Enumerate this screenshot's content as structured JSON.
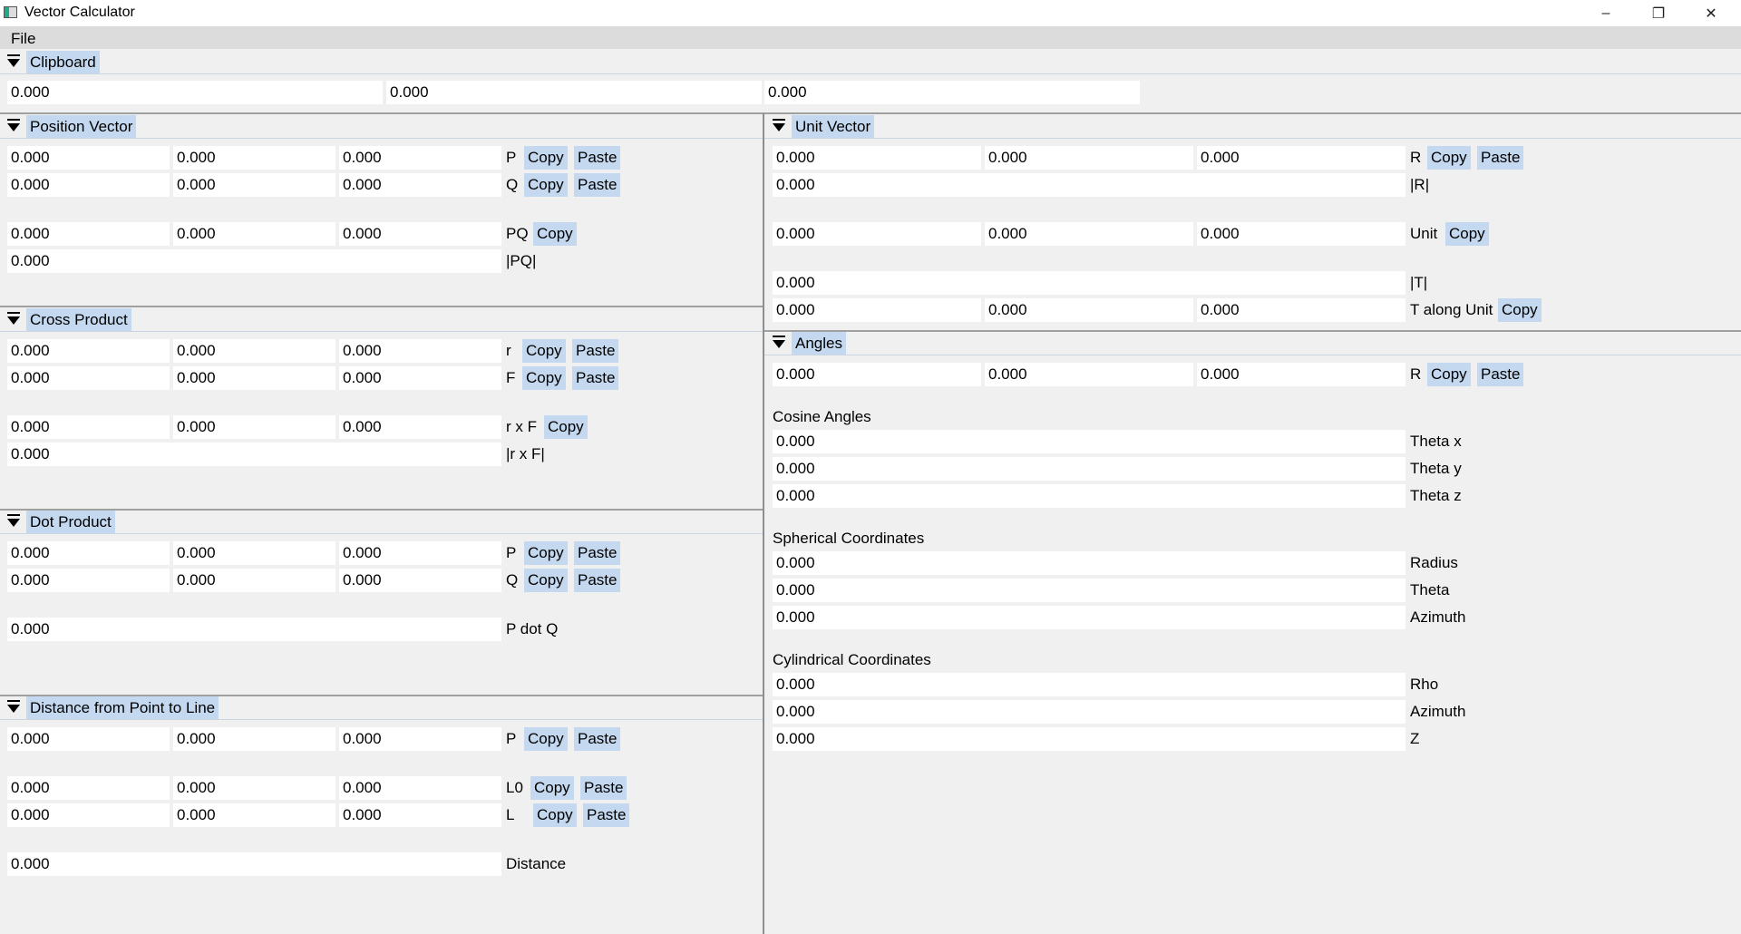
{
  "window": {
    "title": "Vector Calculator",
    "minimize": "–",
    "restore": "❐",
    "close": "✕"
  },
  "menu": {
    "file": "File"
  },
  "clipboard": {
    "title": "Clipboard",
    "values": [
      "0.000",
      "0.000",
      "0.000"
    ]
  },
  "position_vector": {
    "title": "Position Vector",
    "p": {
      "values": [
        "0.000",
        "0.000",
        "0.000"
      ],
      "label": "P"
    },
    "q": {
      "values": [
        "0.000",
        "0.000",
        "0.000"
      ],
      "label": "Q"
    },
    "pq": {
      "values": [
        "0.000",
        "0.000",
        "0.000"
      ],
      "label": "PQ"
    },
    "pq_mag": {
      "value": "0.000",
      "label": "|PQ|"
    }
  },
  "cross_product": {
    "title": "Cross Product",
    "r": {
      "values": [
        "0.000",
        "0.000",
        "0.000"
      ],
      "label": "r"
    },
    "f": {
      "values": [
        "0.000",
        "0.000",
        "0.000"
      ],
      "label": "F"
    },
    "rxf": {
      "values": [
        "0.000",
        "0.000",
        "0.000"
      ],
      "label": "r x F"
    },
    "rxf_mag": {
      "value": "0.000",
      "label": "|r x F|"
    }
  },
  "dot_product": {
    "title": "Dot Product",
    "p": {
      "values": [
        "0.000",
        "0.000",
        "0.000"
      ],
      "label": "P"
    },
    "q": {
      "values": [
        "0.000",
        "0.000",
        "0.000"
      ],
      "label": "Q"
    },
    "pdotq": {
      "value": "0.000",
      "label": "P dot Q"
    }
  },
  "distance": {
    "title": "Distance from Point to Line",
    "p": {
      "values": [
        "0.000",
        "0.000",
        "0.000"
      ],
      "label": "P"
    },
    "l0": {
      "values": [
        "0.000",
        "0.000",
        "0.000"
      ],
      "label": "L0"
    },
    "l": {
      "values": [
        "0.000",
        "0.000",
        "0.000"
      ],
      "label": "L"
    },
    "dist": {
      "value": "0.000",
      "label": "Distance"
    }
  },
  "unit_vector": {
    "title": "Unit Vector",
    "r": {
      "values": [
        "0.000",
        "0.000",
        "0.000"
      ],
      "label": "R"
    },
    "r_mag": {
      "value": "0.000",
      "label": "|R|"
    },
    "unit": {
      "values": [
        "0.000",
        "0.000",
        "0.000"
      ],
      "label": "Unit"
    },
    "t_mag": {
      "value": "0.000",
      "label": "|T|"
    },
    "t_along": {
      "values": [
        "0.000",
        "0.000",
        "0.000"
      ],
      "label": "T along Unit"
    }
  },
  "angles": {
    "title": "Angles",
    "r": {
      "values": [
        "0.000",
        "0.000",
        "0.000"
      ],
      "label": "R"
    },
    "cosine_heading": "Cosine Angles",
    "theta_x": {
      "value": "0.000",
      "label": "Theta x"
    },
    "theta_y": {
      "value": "0.000",
      "label": "Theta y"
    },
    "theta_z": {
      "value": "0.000",
      "label": "Theta z"
    },
    "spherical_heading": "Spherical Coordinates",
    "radius": {
      "value": "0.000",
      "label": "Radius"
    },
    "theta": {
      "value": "0.000",
      "label": "Theta"
    },
    "azimuth": {
      "value": "0.000",
      "label": "Azimuth"
    },
    "cylindrical_heading": "Cylindrical Coordinates",
    "rho": {
      "value": "0.000",
      "label": "Rho"
    },
    "cyl_azimuth": {
      "value": "0.000",
      "label": "Azimuth"
    },
    "z": {
      "value": "0.000",
      "label": "Z"
    }
  },
  "buttons": {
    "copy": "Copy",
    "paste": "Paste"
  }
}
